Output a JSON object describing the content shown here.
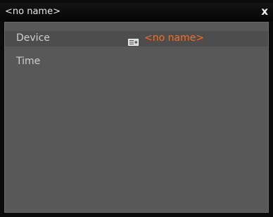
{
  "window": {
    "title": "<no name>",
    "close_label": "x"
  },
  "properties": [
    {
      "label": "Device",
      "value": "<no name>",
      "icon": "device-icon"
    },
    {
      "label": "Time",
      "value": ""
    }
  ],
  "colors": {
    "accent": "#ff6a1a",
    "panel": "#585858",
    "selected_row": "#4d4d4d",
    "titlebar": "#0b0b0b"
  }
}
